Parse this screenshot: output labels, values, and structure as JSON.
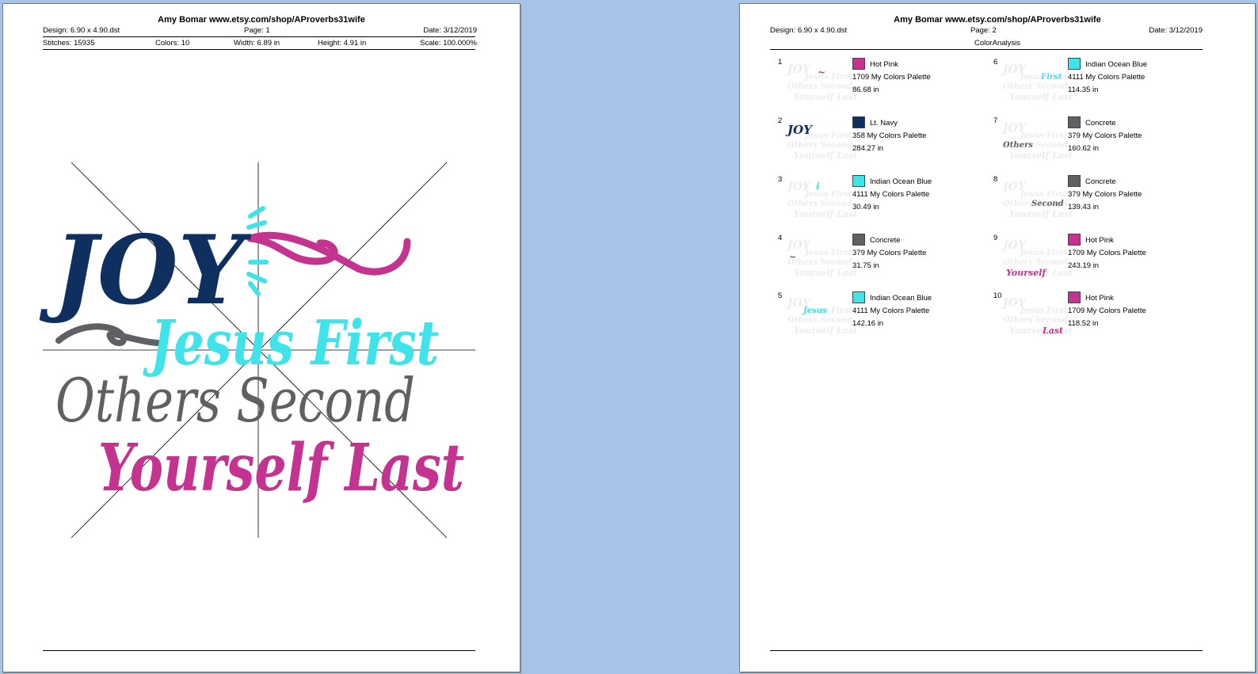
{
  "colors": {
    "navy": "#0f2f5f",
    "aqua": "#3fe3ea",
    "gray": "#5f6063",
    "pink": "#c4338f",
    "desk": "#a6c3e8"
  },
  "page1": {
    "title": "Amy Bomar www.etsy.com/shop/AProverbs31wife",
    "design": "Design: 6.90 x 4.90.dst",
    "page": "Page: 1",
    "date": "Date: 3/12/2019",
    "stitches": "Stitches: 15935",
    "colors_count": "Colors: 10",
    "width": "Width: 6.89 in",
    "height": "Height: 4.91 in",
    "scale": "Scale: 100.000%",
    "artwork": {
      "line1": "JOY",
      "line2": "Jesus First",
      "line3": "Others Second",
      "line4": "Yourself Last"
    }
  },
  "page2": {
    "title": "Amy Bomar www.etsy.com/shop/AProverbs31wife",
    "design": "Design: 6.90 x 4.90.dst",
    "page": "Page: 2",
    "date": "Date: 3/12/2019",
    "section": "ColorAnalysis",
    "items": [
      {
        "num": "1",
        "name": "Hot Pink",
        "palette": "1709 My Colors Palette",
        "length": "86.68 in",
        "color": "#c4338f",
        "thumb": "swirl"
      },
      {
        "num": "2",
        "name": "Lt. Navy",
        "palette": "358 My Colors Palette",
        "length": "284.27 in",
        "color": "#0f2f5f",
        "thumb": "JOY"
      },
      {
        "num": "3",
        "name": "Indian Ocean Blue",
        "palette": "4111 My Colors Palette",
        "length": "30.49 in",
        "color": "#3fe3ea",
        "thumb": "rays"
      },
      {
        "num": "4",
        "name": "Concrete",
        "palette": "379 My Colors Palette",
        "length": "31.75 in",
        "color": "#5f6063",
        "thumb": "curl"
      },
      {
        "num": "5",
        "name": "Indian Ocean Blue",
        "palette": "4111 My Colors Palette",
        "length": "142.16 in",
        "color": "#3fe3ea",
        "thumb": "Jesus"
      },
      {
        "num": "6",
        "name": "Indian Ocean Blue",
        "palette": "4111 My Colors Palette",
        "length": "114.35 in",
        "color": "#3fe3ea",
        "thumb": "First"
      },
      {
        "num": "7",
        "name": "Concrete",
        "palette": "379 My Colors Palette",
        "length": "160.62 in",
        "color": "#5f6063",
        "thumb": "Others"
      },
      {
        "num": "8",
        "name": "Concrete",
        "palette": "379 My Colors Palette",
        "length": "139.43 in",
        "color": "#5f6063",
        "thumb": "Second"
      },
      {
        "num": "9",
        "name": "Hot Pink",
        "palette": "1709 My Colors Palette",
        "length": "243.19 in",
        "color": "#c4338f",
        "thumb": "Yourself"
      },
      {
        "num": "10",
        "name": "Hot Pink",
        "palette": "1709 My Colors Palette",
        "length": "118.52 in",
        "color": "#c4338f",
        "thumb": "Last"
      }
    ]
  }
}
